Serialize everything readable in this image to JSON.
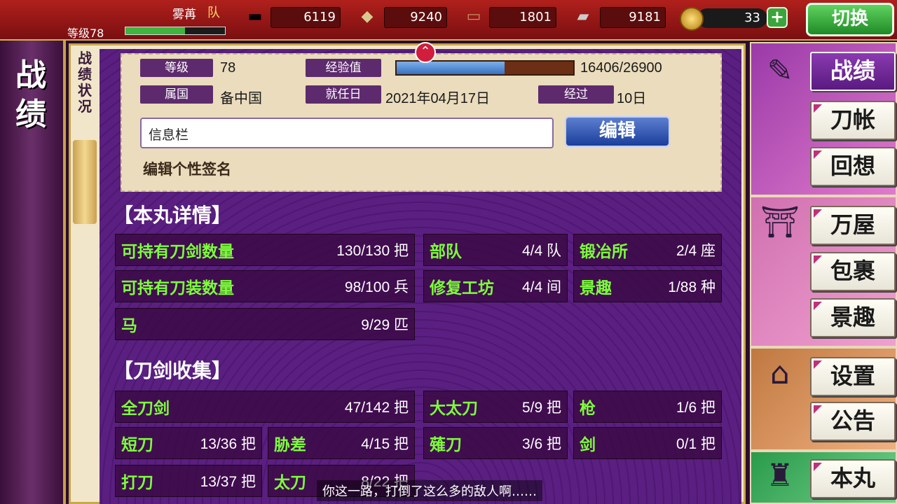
{
  "header": {
    "player_name": "雾苒",
    "team_mark": "队",
    "level_text": "等级78",
    "level_progress": 0.6,
    "resources": [
      {
        "icon": "charcoal-icon",
        "value": "6119"
      },
      {
        "icon": "steel-icon",
        "value": "9240"
      },
      {
        "icon": "coolant-icon",
        "value": "1801"
      },
      {
        "icon": "whetstone-icon",
        "value": "9181"
      }
    ],
    "coins": "33",
    "plus": "+",
    "switch_label": "切换"
  },
  "left_panel": {
    "title_line1": "战",
    "title_line2": "绩"
  },
  "vertical_label": [
    "战",
    "绩",
    "状",
    "况"
  ],
  "profile": {
    "level_label": "等级",
    "level_value": "78",
    "exp_label": "经验值",
    "exp_value": "16406/26900",
    "exp_fraction": 0.61,
    "province_label": "属国",
    "province_value": "备中国",
    "since_label": "就任日",
    "since_value": "2021年04月17日",
    "elapsed_label": "经过",
    "elapsed_value": "10日",
    "message_placeholder": "信息栏",
    "edit_label": "编辑",
    "signature_hint": "编辑个性签名"
  },
  "citadel": {
    "title": "【本丸详情】",
    "rows": [
      [
        {
          "k": "可持有刀剑数量",
          "v": "130/130 把"
        },
        {
          "k": "部队",
          "v": "4/4 队"
        },
        {
          "k": "锻冶所",
          "v": "2/4 座"
        }
      ],
      [
        {
          "k": "可持有刀装数量",
          "v": "98/100 兵"
        },
        {
          "k": "修复工坊",
          "v": "4/4 间"
        },
        {
          "k": "景趣",
          "v": "1/88 种"
        }
      ],
      [
        {
          "k": "马",
          "v": "9/29 匹"
        }
      ]
    ]
  },
  "swords": {
    "title": "【刀剑收集】",
    "rows": [
      [
        {
          "k": "全刀剑",
          "v": "47/142 把"
        },
        {
          "k": "大太刀",
          "v": "5/9 把"
        },
        {
          "k": "枪",
          "v": "1/6 把"
        }
      ],
      [
        {
          "k": "短刀",
          "v": "13/36 把"
        },
        {
          "k": "胁差",
          "v": "4/15 把"
        },
        {
          "k": "薙刀",
          "v": "3/6 把"
        },
        {
          "k": "剑",
          "v": "0/1 把"
        }
      ],
      [
        {
          "k": "打刀",
          "v": "13/37 把"
        },
        {
          "k": "太刀",
          "v": "8/22 把"
        }
      ]
    ]
  },
  "toast": "你这一路，打倒了这么多的敌人啊……",
  "menu": {
    "records": "战绩",
    "sword_book": "刀帐",
    "memories": "回想",
    "shop": "万屋",
    "packages": "包裹",
    "scenery": "景趣",
    "settings": "设置",
    "notice": "公告",
    "citadel": "本丸"
  }
}
